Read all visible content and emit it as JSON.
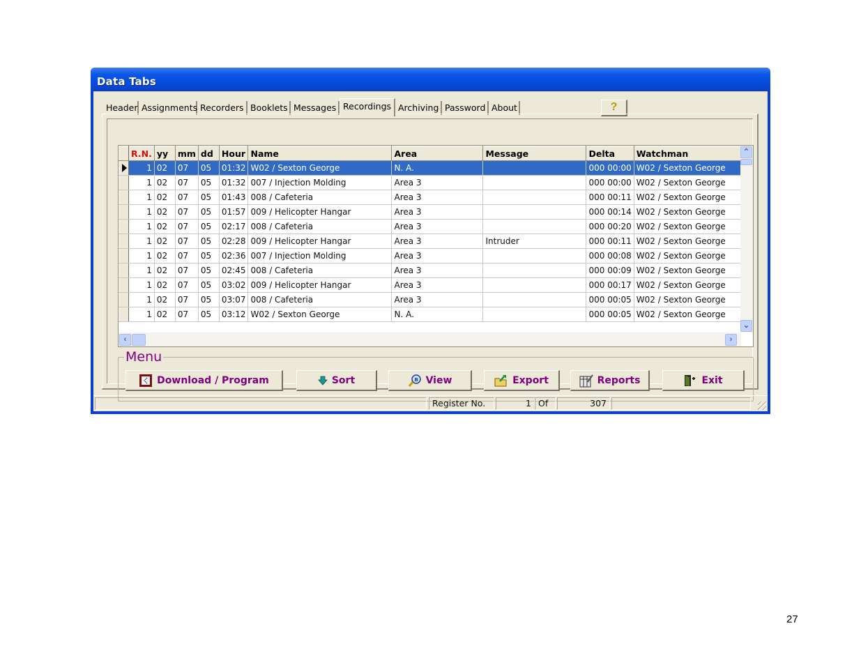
{
  "window": {
    "title": "Data Tabs"
  },
  "tabs": [
    {
      "label": "Header",
      "active": false
    },
    {
      "label": "Assignments",
      "active": false
    },
    {
      "label": "Recorders",
      "active": false
    },
    {
      "label": "Booklets",
      "active": false
    },
    {
      "label": "Messages",
      "active": false
    },
    {
      "label": "Recordings",
      "active": true
    },
    {
      "label": "Archiving",
      "active": false
    },
    {
      "label": "Password",
      "active": false
    },
    {
      "label": "About",
      "active": false
    }
  ],
  "help_button": {
    "label": "?",
    "icon": "help-question-icon"
  },
  "grid": {
    "columns": [
      "R.N.",
      "yy",
      "mm",
      "dd",
      "Hour",
      "Name",
      "Area",
      "Message",
      "Delta",
      "Watchman"
    ],
    "selected_row": 0,
    "rows": [
      [
        "1",
        "02",
        "07",
        "05",
        "01:32",
        "W02 / Sexton George",
        "N. A.",
        "",
        "000 00:00",
        "W02 / Sexton George"
      ],
      [
        "1",
        "02",
        "07",
        "05",
        "01:32",
        "007 / Injection Molding",
        "Area 3",
        "",
        "000 00:00",
        "W02 / Sexton George"
      ],
      [
        "1",
        "02",
        "07",
        "05",
        "01:43",
        "008 / Cafeteria",
        "Area 3",
        "",
        "000 00:11",
        "W02 / Sexton George"
      ],
      [
        "1",
        "02",
        "07",
        "05",
        "01:57",
        "009 / Helicopter Hangar",
        "Area 3",
        "",
        "000 00:14",
        "W02 / Sexton George"
      ],
      [
        "1",
        "02",
        "07",
        "05",
        "02:17",
        "008 / Cafeteria",
        "Area 3",
        "",
        "000 00:20",
        "W02 / Sexton George"
      ],
      [
        "1",
        "02",
        "07",
        "05",
        "02:28",
        "009 / Helicopter Hangar",
        "Area 3",
        "Intruder",
        "000 00:11",
        "W02 / Sexton George"
      ],
      [
        "1",
        "02",
        "07",
        "05",
        "02:36",
        "007 / Injection Molding",
        "Area 3",
        "",
        "000 00:08",
        "W02 / Sexton George"
      ],
      [
        "1",
        "02",
        "07",
        "05",
        "02:45",
        "008 / Cafeteria",
        "Area 3",
        "",
        "000 00:09",
        "W02 / Sexton George"
      ],
      [
        "1",
        "02",
        "07",
        "05",
        "03:02",
        "009 / Helicopter Hangar",
        "Area 3",
        "",
        "000 00:17",
        "W02 / Sexton George"
      ],
      [
        "1",
        "02",
        "07",
        "05",
        "03:07",
        "008 / Cafeteria",
        "Area 3",
        "",
        "000 00:05",
        "W02 / Sexton George"
      ],
      [
        "1",
        "02",
        "07",
        "05",
        "03:12",
        "W02 / Sexton George",
        "N. A.",
        "",
        "000 00:05",
        "W02 / Sexton George"
      ]
    ]
  },
  "menu": {
    "title": "Menu",
    "buttons": [
      {
        "label": "Download / Program",
        "icon": "download-program-icon"
      },
      {
        "label": "Sort",
        "icon": "sort-down-arrow-icon"
      },
      {
        "label": "View",
        "icon": "view-magnifier-icon"
      },
      {
        "label": "Export",
        "icon": "export-folder-icon"
      },
      {
        "label": "Reports",
        "icon": "reports-icon"
      },
      {
        "label": "Exit",
        "icon": "exit-door-icon"
      }
    ]
  },
  "status": {
    "register_label": "Register No.",
    "current": "1",
    "of_label": "Of",
    "total": "307"
  },
  "page_number": "27"
}
